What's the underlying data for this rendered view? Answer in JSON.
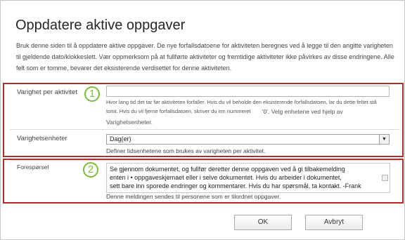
{
  "dialog": {
    "title": "Oppdatere aktive oppgaver",
    "intro": "Bruk denne siden til å oppdatere aktive oppgaver. De nye forfallsdatoene for aktiviteten beregnes ved å legge til den angitte varigheten til gjeldende dato/klokkeslett. Vær oppmerksom på at fullførte aktiviteter og fremtidige aktiviteter ikke påvirkes av disse endringene. Alle felt som er tomme, bevarer det eksisterende verdisettet for denne aktiviteten."
  },
  "callouts": {
    "one": "1",
    "two": "2"
  },
  "fields": {
    "duration": {
      "label": "Varighet per aktivitet",
      "value": "",
      "help_line1": "Hvor lang tid det tar før aktiviteten forfaller. Hvis du vil beholde den eksisterende forfallsdatoen, lar du dette feltet stå",
      "help_line2": "tomt. Hvis du vil fjerne forfallsdatoen, skriver du inn nummeret",
      "help_zero": "'0'. Velg enhetene ved hjelp av",
      "help_line3": "Varighetsenheter."
    },
    "units": {
      "label": "Varighetsenheter",
      "selected": "Dag(er)",
      "help": "Definer tidsenhetene som brukes av varigheten per aktivitet."
    },
    "request": {
      "label": "Forespørsel",
      "line1": "Se gjennom dokumentet, og fullfør deretter denne oppgaven ved å gi tilbakemelding",
      "line2": "enten i • oppgaveskjemaet eller i selve dokumentet. Hvis du arbeider i dokumentet,",
      "line3": "sett bare inn sporede endringer og kommentarer. Hvis du har spørsmål, ta kontakt. -Frank",
      "help": "Denne meldingen sendes til personene som er tilordnet oppgaver."
    }
  },
  "buttons": {
    "ok": "OK",
    "cancel": "Avbryt"
  },
  "colors": {
    "highlight_box": "#b22a2a",
    "callout": "#7bbd3a"
  }
}
